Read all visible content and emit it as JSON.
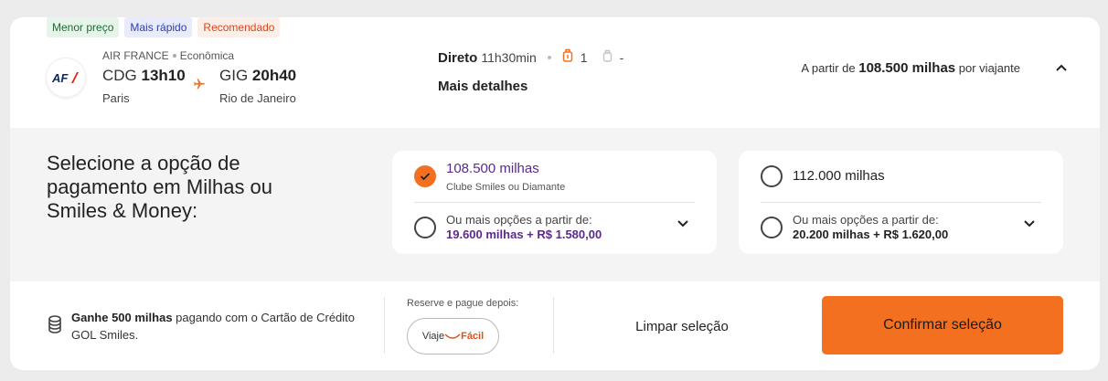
{
  "tags": [
    {
      "label": "Menor preço"
    },
    {
      "label": "Mais rápido"
    },
    {
      "label": "Recomendado"
    }
  ],
  "flight": {
    "airline": "AIR FRANCE",
    "cabin": "Econômica",
    "logo_text": "AF",
    "origin_code": "CDG",
    "origin_time": "13h10",
    "origin_city": "Paris",
    "dest_code": "GIG",
    "dest_time": "20h40",
    "dest_city": "Rio de Janeiro",
    "stops": "Direto",
    "duration": "11h30min",
    "baggage_count": "1",
    "carry_on": "-",
    "details_label": "Mais detalhes",
    "price_prefix": "A partir de",
    "price": "108.500 milhas",
    "price_suffix": "por viajante"
  },
  "payment": {
    "title": "Selecione a opção de pagamento em Milhas ou Smiles & Money:",
    "options": [
      {
        "main": "108.500 milhas",
        "sub": "Clube Smiles ou Diamante",
        "more_label": "Ou mais opções a partir de:",
        "more_value": "19.600 milhas + R$ 1.580,00",
        "selected": true
      },
      {
        "main": "112.000 milhas",
        "sub": "",
        "more_label": "Ou mais opções a partir de:",
        "more_value": "20.200 milhas + R$ 1.620,00",
        "selected": false
      }
    ]
  },
  "footer": {
    "gain_bold": "Ganhe 500 milhas",
    "gain_text": " pagando com o Cartão de Crédito GOL Smiles.",
    "reserve_label": "Reserve e pague depois:",
    "viaje_a": "Viaje",
    "viaje_b": "Fácil",
    "clear_label": "Limpar seleção",
    "confirm_label": "Confirmar seleção"
  },
  "colors": {
    "accent": "#f37021",
    "purple": "#5a2a8c"
  }
}
